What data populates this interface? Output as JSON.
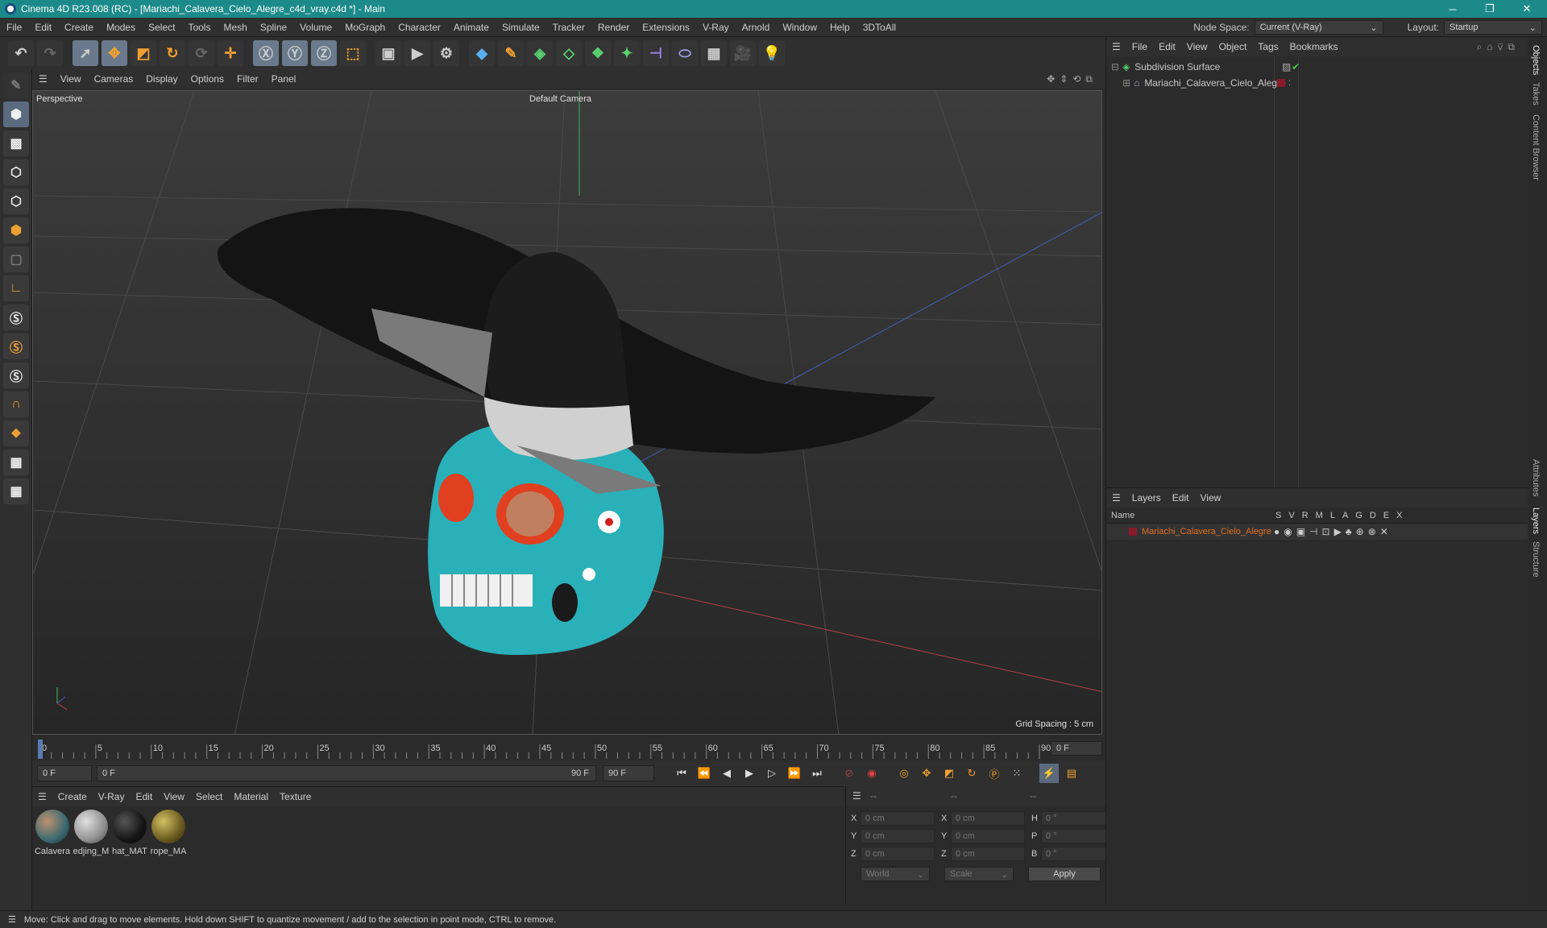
{
  "titlebar": {
    "title": "Cinema 4D R23.008 (RC) - [Mariachi_Calavera_Cielo_Alegre_c4d_vray.c4d *] - Main"
  },
  "menu": [
    "File",
    "Edit",
    "Create",
    "Modes",
    "Select",
    "Tools",
    "Mesh",
    "Spline",
    "Volume",
    "MoGraph",
    "Character",
    "Animate",
    "Simulate",
    "Tracker",
    "Render",
    "Extensions",
    "V-Ray",
    "Arnold",
    "Window",
    "Help",
    "3DToAll"
  ],
  "nodespace": {
    "label": "Node Space:",
    "value": "Current (V-Ray)"
  },
  "layout": {
    "label": "Layout:",
    "value": "Startup"
  },
  "viewport": {
    "menu": [
      "View",
      "Cameras",
      "Display",
      "Options",
      "Filter",
      "Panel"
    ],
    "name": "Perspective",
    "camera": "Default Camera",
    "grid_spacing": "Grid Spacing : 5 cm"
  },
  "timeline": {
    "ticks": [
      "0",
      "5",
      "10",
      "15",
      "20",
      "25",
      "30",
      "35",
      "40",
      "45",
      "50",
      "55",
      "60",
      "65",
      "70",
      "75",
      "80",
      "85",
      "90"
    ],
    "current": "0 F"
  },
  "transport": {
    "start": "0 F",
    "range_start": "0 F",
    "range_end": "90 F",
    "end": "90 F"
  },
  "materials": {
    "menu": [
      "Create",
      "V-Ray",
      "Edit",
      "View",
      "Select",
      "Material",
      "Texture"
    ],
    "items": [
      {
        "name": "Calavera",
        "color": "#6a8a8a"
      },
      {
        "name": "edjing_M",
        "color": "#a0a0a0"
      },
      {
        "name": "hat_MAT",
        "color": "#1a1a1a"
      },
      {
        "name": "rope_MA",
        "color": "#8a7a30"
      }
    ]
  },
  "coords": {
    "headers": [
      "--",
      "--",
      "--"
    ],
    "rows": [
      {
        "a": "X",
        "av": "0 cm",
        "b": "X",
        "bv": "0 cm",
        "c": "H",
        "cv": "0 °"
      },
      {
        "a": "Y",
        "av": "0 cm",
        "b": "Y",
        "bv": "0 cm",
        "c": "P",
        "cv": "0 °"
      },
      {
        "a": "Z",
        "av": "0 cm",
        "b": "Z",
        "bv": "0 cm",
        "c": "B",
        "cv": "0 °"
      }
    ],
    "world": "World",
    "scale": "Scale",
    "apply": "Apply"
  },
  "objects": {
    "menu": [
      "File",
      "Edit",
      "View",
      "Object",
      "Tags",
      "Bookmarks"
    ],
    "items": [
      "Subdivision Surface",
      "Mariachi_Calavera_Cielo_Alegre"
    ]
  },
  "layers": {
    "menu": [
      "Layers",
      "Edit",
      "View"
    ],
    "col_name": "Name",
    "cols": [
      "S",
      "V",
      "R",
      "M",
      "L",
      "A",
      "G",
      "D",
      "E",
      "X"
    ],
    "item": "Mariachi_Calavera_Cielo_Alegre",
    "item_color": "#e07020"
  },
  "sidetabs": [
    "Objects",
    "Takes",
    "Content Browser",
    "Attributes",
    "Layers",
    "Structure"
  ],
  "status": "Move: Click and drag to move elements. Hold down SHIFT to quantize movement / add to the selection in point mode, CTRL to remove."
}
